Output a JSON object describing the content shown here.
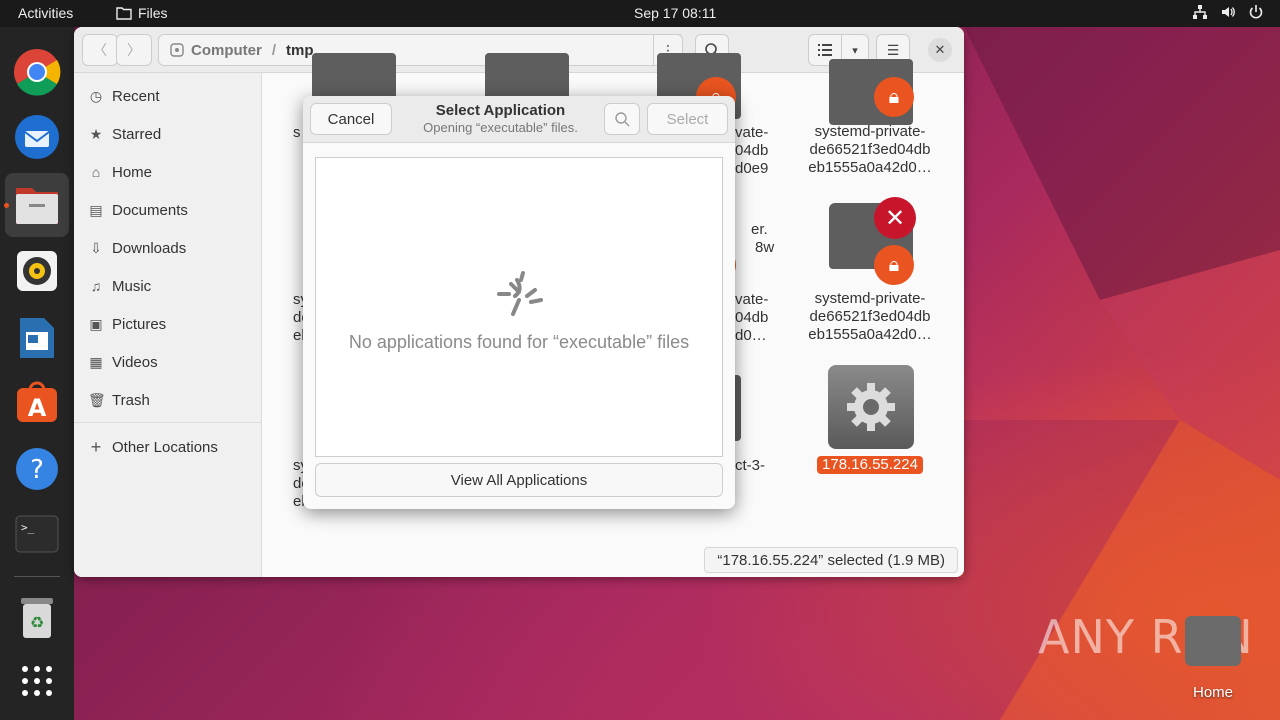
{
  "topbar": {
    "activities": "Activities",
    "app_name": "Files",
    "clock": "Sep 17  08:11"
  },
  "dock": {
    "items": [
      "chrome-icon",
      "thunderbird-icon",
      "files-icon",
      "rhythmbox-icon",
      "writer-icon",
      "app-center-icon",
      "help-icon",
      "terminal-icon",
      "trash-icon",
      "show-apps-icon"
    ]
  },
  "files_window": {
    "path": {
      "computer": "Computer",
      "separator": "/",
      "current": "tmp"
    },
    "sidebar": {
      "items": [
        {
          "label": "Recent",
          "icon": "clock-icon"
        },
        {
          "label": "Starred",
          "icon": "star-icon"
        },
        {
          "label": "Home",
          "icon": "home-icon"
        },
        {
          "label": "Documents",
          "icon": "document-icon"
        },
        {
          "label": "Downloads",
          "icon": "download-icon"
        },
        {
          "label": "Music",
          "icon": "music-icon"
        },
        {
          "label": "Pictures",
          "icon": "picture-icon"
        },
        {
          "label": "Videos",
          "icon": "video-icon"
        },
        {
          "label": "Trash",
          "icon": "trash-icon"
        }
      ],
      "other_locations": "Other Locations"
    },
    "files": [
      {
        "name_lines": [
          "systemd-private-",
          "de66521f3ed04db",
          "eb1555a0a42d0…"
        ]
      },
      {
        "name_lines": [
          "systemd-private-",
          "de66521f3ed04db",
          "eb1555a0a42d0…"
        ]
      },
      {
        "name_lines": [
          "178.16.55.224"
        ]
      }
    ],
    "partial_labels": {
      "col1_a": "s",
      "col1_b": [
        "sy",
        "de",
        "eb"
      ],
      "col1_c": [
        "sy",
        "de",
        "eb"
      ],
      "col3_a": [
        "vate-",
        "04db",
        "d0e9"
      ],
      "col3_b": [
        "er.",
        "8w"
      ],
      "col3_c": [
        "vate-",
        "04db",
        "d0…"
      ],
      "col3_d": "ct-3-"
    },
    "status": "“178.16.55.224” selected (1.9 MB)"
  },
  "dialog": {
    "cancel": "Cancel",
    "title": "Select Application",
    "subtitle": "Opening “executable” files.",
    "select": "Select",
    "empty_message": "No applications found for “executable” files",
    "view_all": "View All Applications"
  },
  "desktop": {
    "watermark": "ANY RUN",
    "home_label": "Home"
  },
  "colors": {
    "accent": "#e95420",
    "topbar": "#1a1a1a",
    "dock": "#242424"
  }
}
